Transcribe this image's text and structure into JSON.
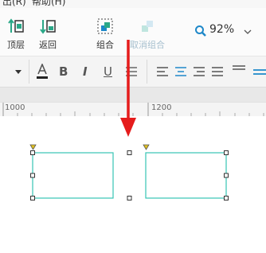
{
  "menubar": {
    "items": [
      "出(R)",
      "帮助(H)"
    ]
  },
  "ribbon": {
    "top_label": "顶层",
    "back_label": "返回",
    "group_label": "组合",
    "ungroup_label": "取消组合",
    "zoom_value": "92%"
  },
  "format": {
    "bold": "B",
    "italic": "I",
    "underline": "U"
  },
  "ruler": {
    "left_label": "1000",
    "right_label": "1200"
  },
  "colors": {
    "accent": "#1e88c9",
    "shape_stroke": "#36c4b4",
    "arrow": "#e51c1c",
    "marker": "#e0c020"
  }
}
